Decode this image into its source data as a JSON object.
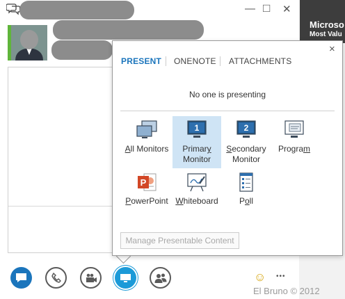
{
  "background": {
    "tile_line1": "Microso",
    "tile_line2": "Most Valu"
  },
  "window": {
    "minimize_glyph": "—",
    "maximize_glyph": "□",
    "close_glyph": "✕"
  },
  "popup": {
    "close_glyph": "×",
    "tabs": [
      {
        "label": "PRESENT",
        "active": true
      },
      {
        "label": "ONENOTE",
        "active": false
      },
      {
        "label": "ATTACHMENTS",
        "active": false
      }
    ],
    "status": "No one is presenting",
    "options": [
      {
        "label_prefix": "",
        "label_underline": "A",
        "label_rest": "ll Monitors",
        "label_line2": ""
      },
      {
        "label_prefix": "Primar",
        "label_underline": "y",
        "label_rest": "",
        "label_line2": "Monitor",
        "number": "1"
      },
      {
        "label_prefix": "",
        "label_underline": "S",
        "label_rest": "econdary",
        "label_line2": "Monitor",
        "number": "2"
      },
      {
        "label_prefix": "Progra",
        "label_underline": "m",
        "label_rest": "",
        "label_line2": ""
      },
      {
        "label_prefix": "",
        "label_underline": "P",
        "label_rest": "owerPoint",
        "label_line2": ""
      },
      {
        "label_prefix": "",
        "label_underline": "W",
        "label_rest": "hiteboard",
        "label_line2": ""
      },
      {
        "label_prefix": "P",
        "label_underline": "o",
        "label_rest": "ll",
        "label_line2": ""
      }
    ],
    "manage_button": "Manage Presentable Content"
  },
  "toolbar": {
    "emoji": "☺",
    "more": "•••"
  },
  "watermark": "El Bruno © 2012",
  "colors": {
    "accent": "#1b75bc",
    "highlight": "#cfe4f5",
    "powerpoint": "#d24726"
  }
}
